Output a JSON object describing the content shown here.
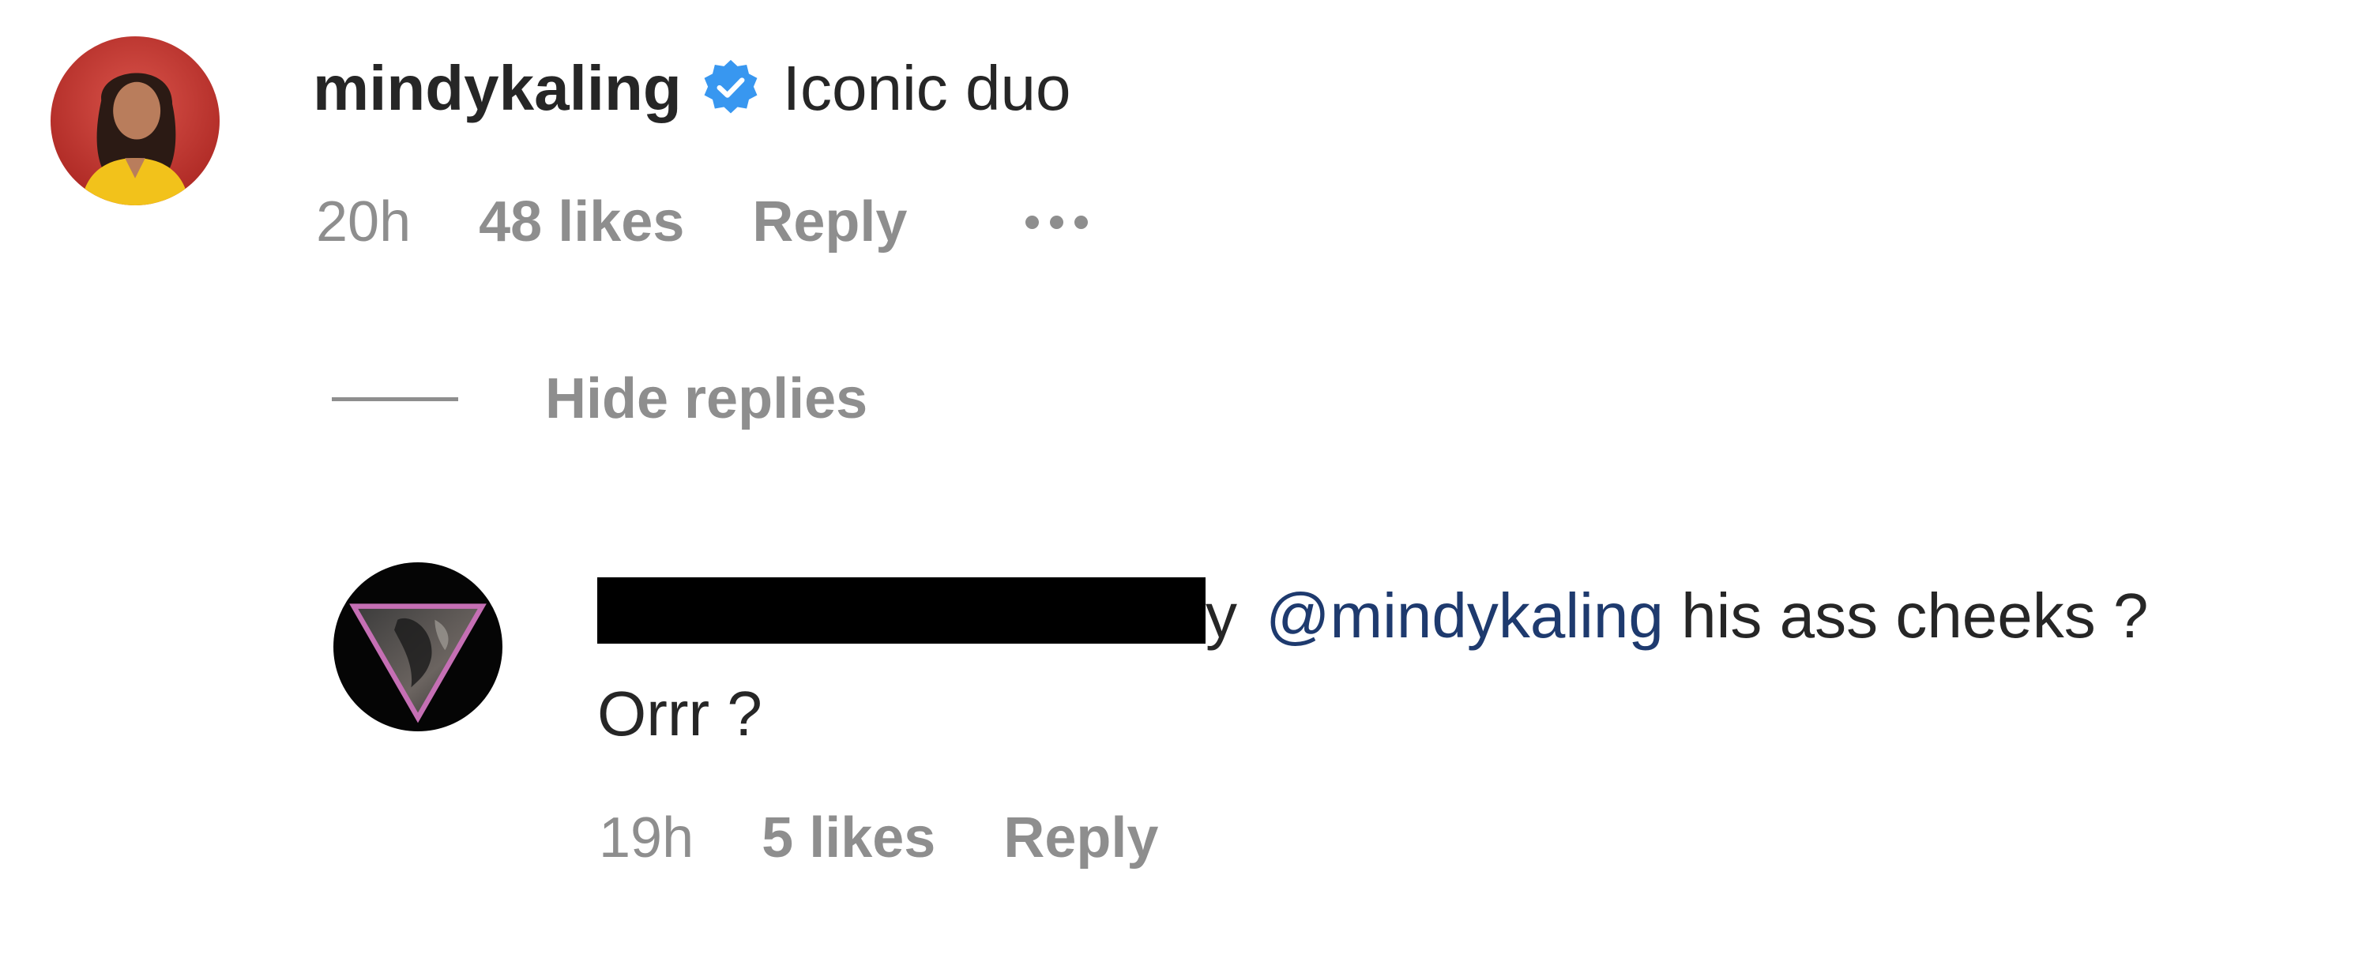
{
  "comment": {
    "username": "mindykaling",
    "verified_icon": "verified-badge-icon",
    "verified_color": "#3897f0",
    "text": "Iconic duo",
    "time": "20h",
    "likes": "48 likes",
    "reply_label": "Reply",
    "more_icon": "more-dots-icon"
  },
  "hide_replies": {
    "label": "Hide replies"
  },
  "reply": {
    "username_visible_tail": "y",
    "mention": "@mindykaling",
    "text_line1": " his ass cheeks ?",
    "text_line2": "Orrr ?",
    "time": "19h",
    "likes": "5 likes",
    "reply_label": "Reply"
  },
  "colors": {
    "meta_gray": "#8e8e8e",
    "text": "#262626",
    "mention": "#1e3a6e",
    "redaction": "#000000"
  }
}
